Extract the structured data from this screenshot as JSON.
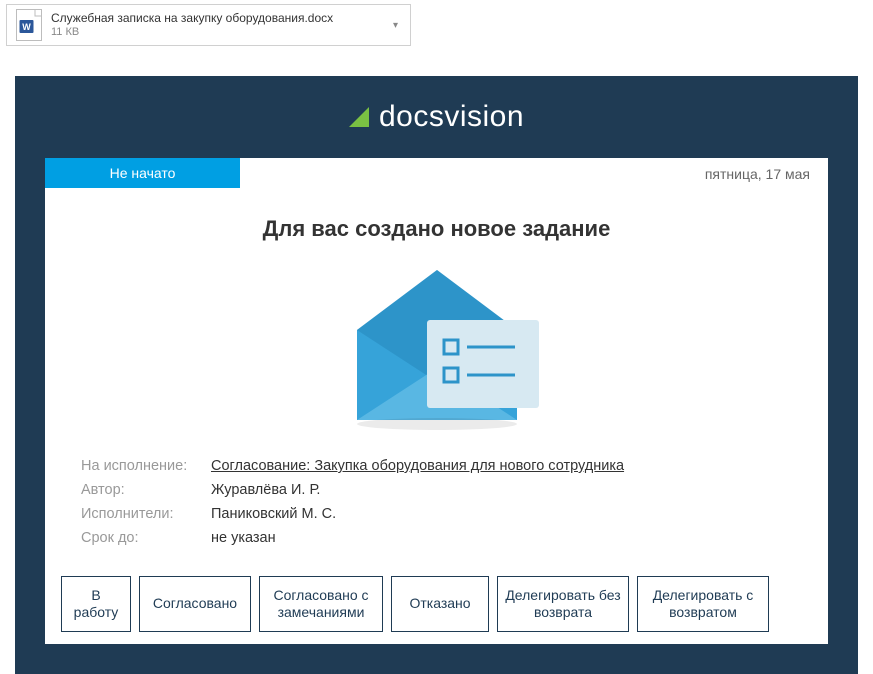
{
  "attachment": {
    "filename": "Служебная записка на закупку оборудования.docx",
    "size": "11 КВ"
  },
  "brand": {
    "name": "docsvision"
  },
  "status": "Не начато",
  "date": "пятница, 17 мая",
  "headline": "Для вас создано новое задание",
  "meta": {
    "labels": {
      "subject": "На исполнение:",
      "author": "Автор:",
      "assignees": "Исполнители:",
      "due": "Срок до:"
    },
    "values": {
      "subject": "Согласование: Закупка оборудования для нового сотрудника",
      "author": "Журавлёва И. Р.",
      "assignees": "Паниковский М. С.",
      "due": "не указан"
    }
  },
  "actions": {
    "start": "В работу",
    "approved": "Согласовано",
    "approved_with_notes": "Согласовано с замечаниями",
    "rejected": "Отказано",
    "delegate_no_return": "Делегировать без возврата",
    "delegate_return": "Делегировать с возвратом"
  }
}
